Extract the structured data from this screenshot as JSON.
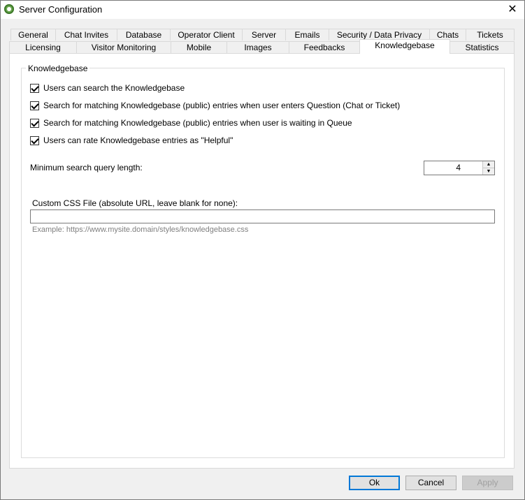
{
  "window": {
    "title": "Server Configuration",
    "close_symbol": "✕"
  },
  "tabs_row1": [
    "General",
    "Chat Invites",
    "Database",
    "Operator Client",
    "Server",
    "Emails",
    "Security / Data Privacy",
    "Chats",
    "Tickets"
  ],
  "tabs_row2": [
    "Licensing",
    "Visitor Monitoring",
    "Mobile",
    "Images",
    "Feedbacks",
    "Knowledgebase",
    "Statistics"
  ],
  "active_tab": "Knowledgebase",
  "group": {
    "title": "Knowledgebase"
  },
  "options": [
    {
      "label": "Users can search the Knowledgebase",
      "checked": true
    },
    {
      "label": "Search for matching Knowledgebase (public) entries when user enters Question (Chat or Ticket)",
      "checked": true
    },
    {
      "label": "Search for matching Knowledgebase (public) entries when user is waiting in Queue",
      "checked": true
    },
    {
      "label": "Users can rate Knowledgebase entries as \"Helpful\"",
      "checked": true
    }
  ],
  "min_query": {
    "label": "Minimum search query length:",
    "value": "4"
  },
  "css_file": {
    "label": "Custom CSS File (absolute URL, leave blank for none):",
    "value": "",
    "hint": "Example: https://www.mysite.domain/styles/knowledgebase.css"
  },
  "buttons": {
    "ok": "Ok",
    "cancel": "Cancel",
    "apply": "Apply"
  }
}
